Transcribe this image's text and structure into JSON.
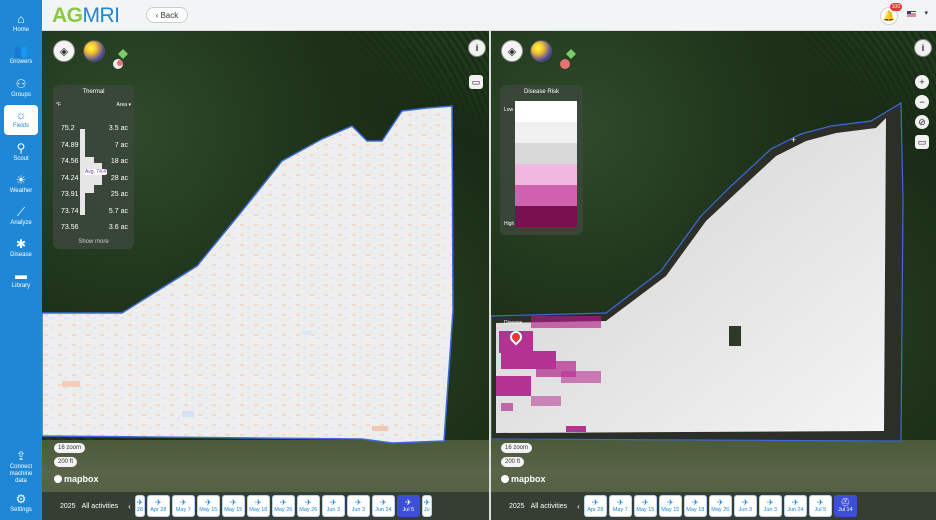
{
  "sidebar": {
    "items": [
      {
        "key": "home",
        "label": "Home",
        "icon": "⌂"
      },
      {
        "key": "growers",
        "label": "Growers",
        "icon": "👥"
      },
      {
        "key": "groups",
        "label": "Groups",
        "icon": "⚇"
      },
      {
        "key": "fields",
        "label": "Fields",
        "icon": "☼",
        "active": true
      },
      {
        "key": "scout",
        "label": "Scout",
        "icon": "⚲"
      },
      {
        "key": "weather",
        "label": "Weather",
        "icon": "☀"
      },
      {
        "key": "analyze",
        "label": "Analyze",
        "icon": "⟋"
      },
      {
        "key": "disease",
        "label": "Disease",
        "icon": "✱"
      },
      {
        "key": "library",
        "label": "Library",
        "icon": "▬"
      }
    ],
    "bottom_items": [
      {
        "key": "connect",
        "label_lines": [
          "Connect",
          "machine",
          "data"
        ],
        "icon": "⇪"
      },
      {
        "key": "settings",
        "label": "Settings",
        "icon": "⚙"
      }
    ]
  },
  "header": {
    "logo_part1": "AG",
    "logo_part2": "MRI",
    "back_label": "Back",
    "notification_count": "100"
  },
  "colors": {
    "sidebar": "#1e88d6",
    "logo_green": "#8dc63f",
    "selected_date": "#3d4fd6",
    "field_boundary": "#3c6bd8"
  },
  "left_map": {
    "legend": {
      "title": "Thermal",
      "unit_col": "°F",
      "area_col": "Area ▾",
      "rows": [
        {
          "temp": "75.2",
          "area": "3.5 ac"
        },
        {
          "temp": "74.89",
          "area": "7 ac"
        },
        {
          "temp": "74.56",
          "area": "18 ac"
        },
        {
          "temp": "74.24",
          "area": "28 ac"
        },
        {
          "temp": "73.91",
          "area": "25 ac"
        },
        {
          "temp": "73.74",
          "area": "5.7 ac"
        },
        {
          "temp": "73.56",
          "area": "3.6 ac"
        }
      ],
      "avg_label": "Avg. 74.4",
      "show_more": "Show more"
    },
    "zoom_label": "16 zoom",
    "scale_label": "200 ft",
    "mapbox_label": "mapbox",
    "timeline": {
      "year": "2025",
      "filter": "All activities",
      "dates": [
        "28",
        "Apr 28",
        "May 7",
        "May 15",
        "May 15",
        "May 18",
        "May 26",
        "May 26",
        "Jun 3",
        "Jun 3",
        "Jun 24",
        "Jul 5",
        "Ju"
      ],
      "selected": "Jul 5"
    }
  },
  "right_map": {
    "legend": {
      "title": "Disease Risk",
      "low_label": "Low",
      "high_label": "High",
      "swatches": [
        "#ffffff",
        "#f0f0f0",
        "#d8d8d8",
        "#f0b8e0",
        "#d060b0",
        "#7a1050"
      ]
    },
    "pin_label": "Disease",
    "zoom_label": "16 zoom",
    "scale_label": "200 ft",
    "mapbox_label": "mapbox",
    "timeline": {
      "year": "2025",
      "filter": "All activities",
      "dates": [
        "Apr 28",
        "May 7",
        "May 15",
        "May 15",
        "May 18",
        "May 26",
        "Jun 3",
        "Jun 3",
        "Jun 24",
        "Jul 5",
        "Jul 14"
      ],
      "selected": "Jul 14"
    }
  }
}
